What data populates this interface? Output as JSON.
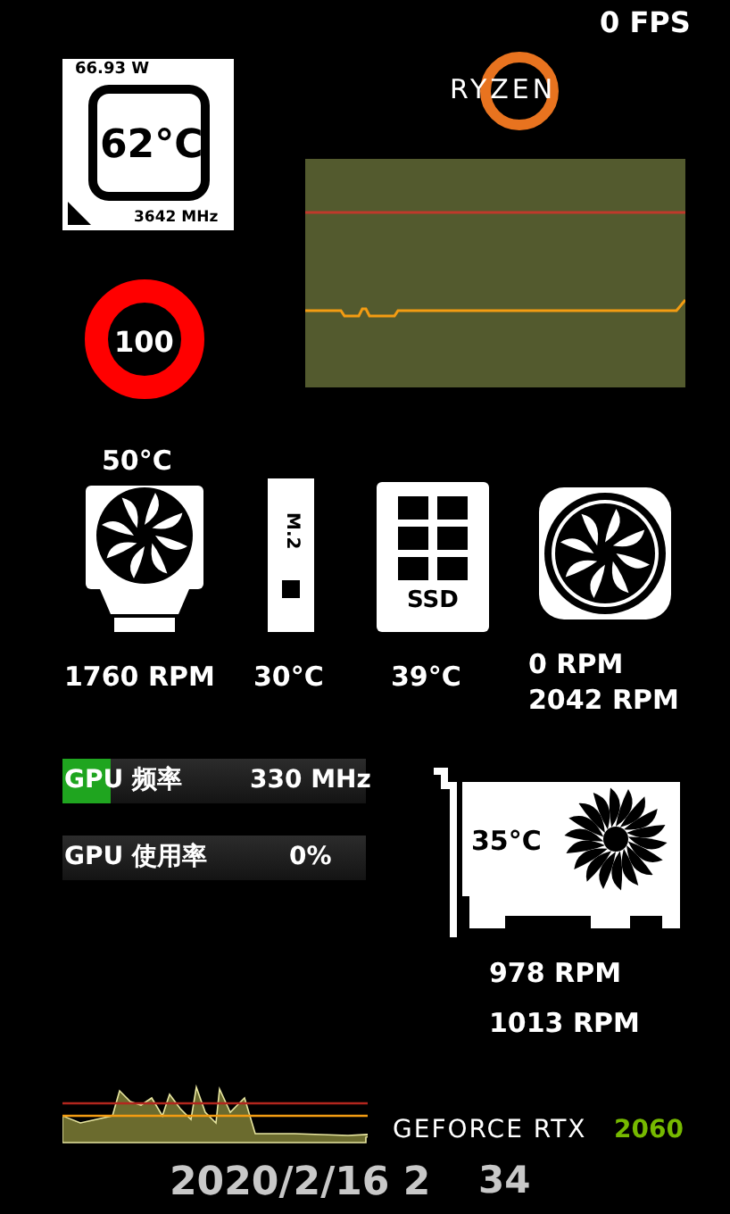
{
  "fps": "0 FPS",
  "cpu": {
    "power": "66.93 W",
    "temp": "62°C",
    "clock": "3642 MHz"
  },
  "brand_logo": {
    "text": "RYZEN"
  },
  "cpu_load": {
    "value": "100"
  },
  "cooler": {
    "temp": "50°C",
    "rpm": "1760 RPM"
  },
  "m2": {
    "label": "M.2",
    "temp": "30°C"
  },
  "ssd": {
    "label": "SSD",
    "temp": "39°C"
  },
  "case_fan": {
    "rpms": [
      "0 RPM",
      "2042 RPM"
    ]
  },
  "gpu_bars": [
    {
      "label": "GPU 频率",
      "value": "330 MHz",
      "level": 0.16
    },
    {
      "label": "GPU 使用率",
      "value": "0%",
      "level": 0
    }
  ],
  "gpu": {
    "temp": "35°C",
    "rpms": [
      "978 RPM",
      "1013 RPM"
    ]
  },
  "gpu_brand": {
    "name": "GEFORCE RTX",
    "model": "2060"
  },
  "datetime": {
    "date": "2020/2/16 2",
    "time": "34"
  }
}
